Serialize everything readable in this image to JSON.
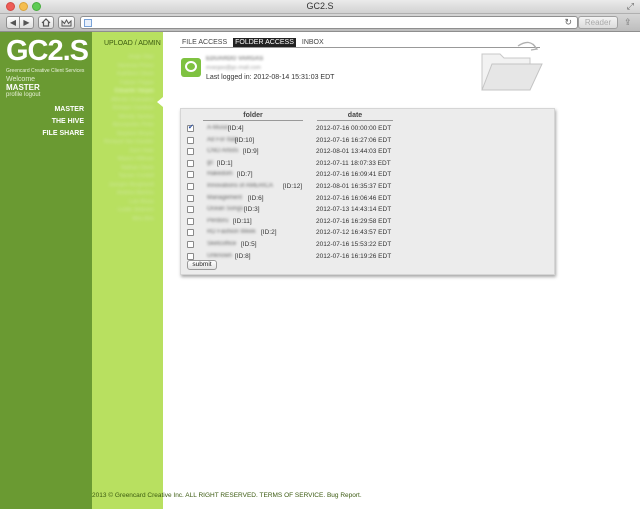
{
  "window": {
    "title": "GC2.S"
  },
  "browser": {
    "reader_label": "Reader"
  },
  "sidebar": {
    "logo": "GC2.S",
    "tagline": "Greencard Creative Client Services",
    "welcome": "Welcome",
    "username": "MASTER",
    "profile_link": "profile",
    "logout_link": "logout",
    "nav": [
      {
        "label": "MASTER"
      },
      {
        "label": "THE HIVE"
      },
      {
        "label": "FILE SHARE"
      }
    ]
  },
  "members_panel": {
    "upload_admin": "UPLOAD / ADMIN",
    "members": [
      "Jorge Diaz",
      "Vanessa Perez",
      "Kathleen Davis",
      "Fabian Pagan",
      "Eduardo Vargas",
      "Alfredo Granados",
      "Enrique Cardoso",
      "Wendy Santos",
      "Alessandro Pinto",
      "Stephen Reyes",
      "Renaud Van Gander",
      "Zach Hale",
      "Mason Hillman",
      "Nathan Davis",
      "Tanner Cordell",
      "Juergen Burghardt",
      "Andrea Martins",
      "Luis Rivas",
      "Leslie Jimenez",
      "Wes Brix"
    ]
  },
  "tabs": [
    {
      "label": "FILE ACCESS"
    },
    {
      "label": "FOLDER ACCESS"
    },
    {
      "label": "INBOX"
    }
  ],
  "user": {
    "name": "EDUARDO VARGAS",
    "email": "evargas@gc-mail.com",
    "last_login": "Last logged in: 2012-08-14 15:31:03 EDT"
  },
  "folder_table": {
    "headers": {
      "folder": "folder",
      "date": "date"
    },
    "rows": [
      {
        "name": "A-Music",
        "id": "[ID:4]",
        "date": "2012-07-16 00:00:00 EDT",
        "checked": true
      },
      {
        "name": "Ad For Italy",
        "id": "[ID:10]",
        "date": "2012-07-16 16:27:06 EDT",
        "checked": false
      },
      {
        "name": "CNO Artists",
        "id": "[ID:9]",
        "date": "2012-08-01 13:44:03 EDT",
        "checked": false
      },
      {
        "name": "gc",
        "id": "[ID:1]",
        "date": "2012-07-11 18:07:33 EDT",
        "checked": false
      },
      {
        "name": "Hakedom",
        "id": "[ID:7]",
        "date": "2012-07-16 16:09:41 EDT",
        "checked": false
      },
      {
        "name": "Innovations of AMERICA",
        "id": "[ID:12]",
        "date": "2012-08-01 16:35:37 EDT",
        "checked": false
      },
      {
        "name": "Management",
        "id": "[ID:6]",
        "date": "2012-07-16 16:06:46 EDT",
        "checked": false
      },
      {
        "name": "Ocean Songs",
        "id": "[ID:3]",
        "date": "2012-07-13 14:43:14 EDT",
        "checked": false
      },
      {
        "name": "Perdoru",
        "id": "[ID:11]",
        "date": "2012-07-16 16:29:58 EDT",
        "checked": false
      },
      {
        "name": "RD Fashion Week",
        "id": "[ID:2]",
        "date": "2012-07-12 16:43:57 EDT",
        "checked": false
      },
      {
        "name": "Sketcoffice",
        "id": "[ID:5]",
        "date": "2012-07-16 15:53:22 EDT",
        "checked": false
      },
      {
        "name": "Unknown",
        "id": "[ID:8]",
        "date": "2012-07-16 16:19:26 EDT",
        "checked": false
      }
    ],
    "submit_label": "submit"
  },
  "footer": {
    "copyright": "2013 © Greencard Creative Inc. ALL RIGHT RESERVED.",
    "terms": "TERMS OF SERVICE.",
    "bug": "Bug Report."
  }
}
